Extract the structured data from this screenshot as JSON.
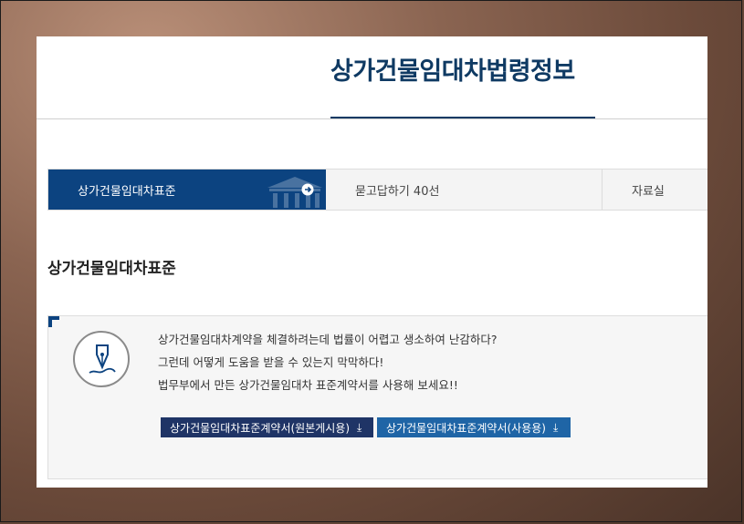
{
  "header": {
    "title": "상가건물임대차법령정보"
  },
  "tabs": [
    {
      "label": "상가건물임대차표준",
      "active": true
    },
    {
      "label": "묻고답하기 40선",
      "active": false
    },
    {
      "label": "자료실",
      "active": false
    }
  ],
  "section": {
    "title": "상가건물임대차표준"
  },
  "info": {
    "lines": [
      "상가건물임대차계약을 체결하려는데 법률이 어렵고 생소하여 난감하다?",
      "그런데 어떻게 도움을 받을 수 있는지 막막하다!",
      "법무부에서 만든 상가건물임대차 표준계약서를 사용해 보세요!!"
    ],
    "icon": "fountain-pen-icon"
  },
  "downloads": [
    {
      "label": "상가건물임대차표준계약서(원본게시용)",
      "icon": "download-icon",
      "color": "#1f3466"
    },
    {
      "label": "상가건물임대차표준계약서(사용용)",
      "icon": "download-icon",
      "color": "#1f65a6"
    }
  ],
  "colors": {
    "primary": "#0c4380",
    "title": "#0f3a63"
  }
}
